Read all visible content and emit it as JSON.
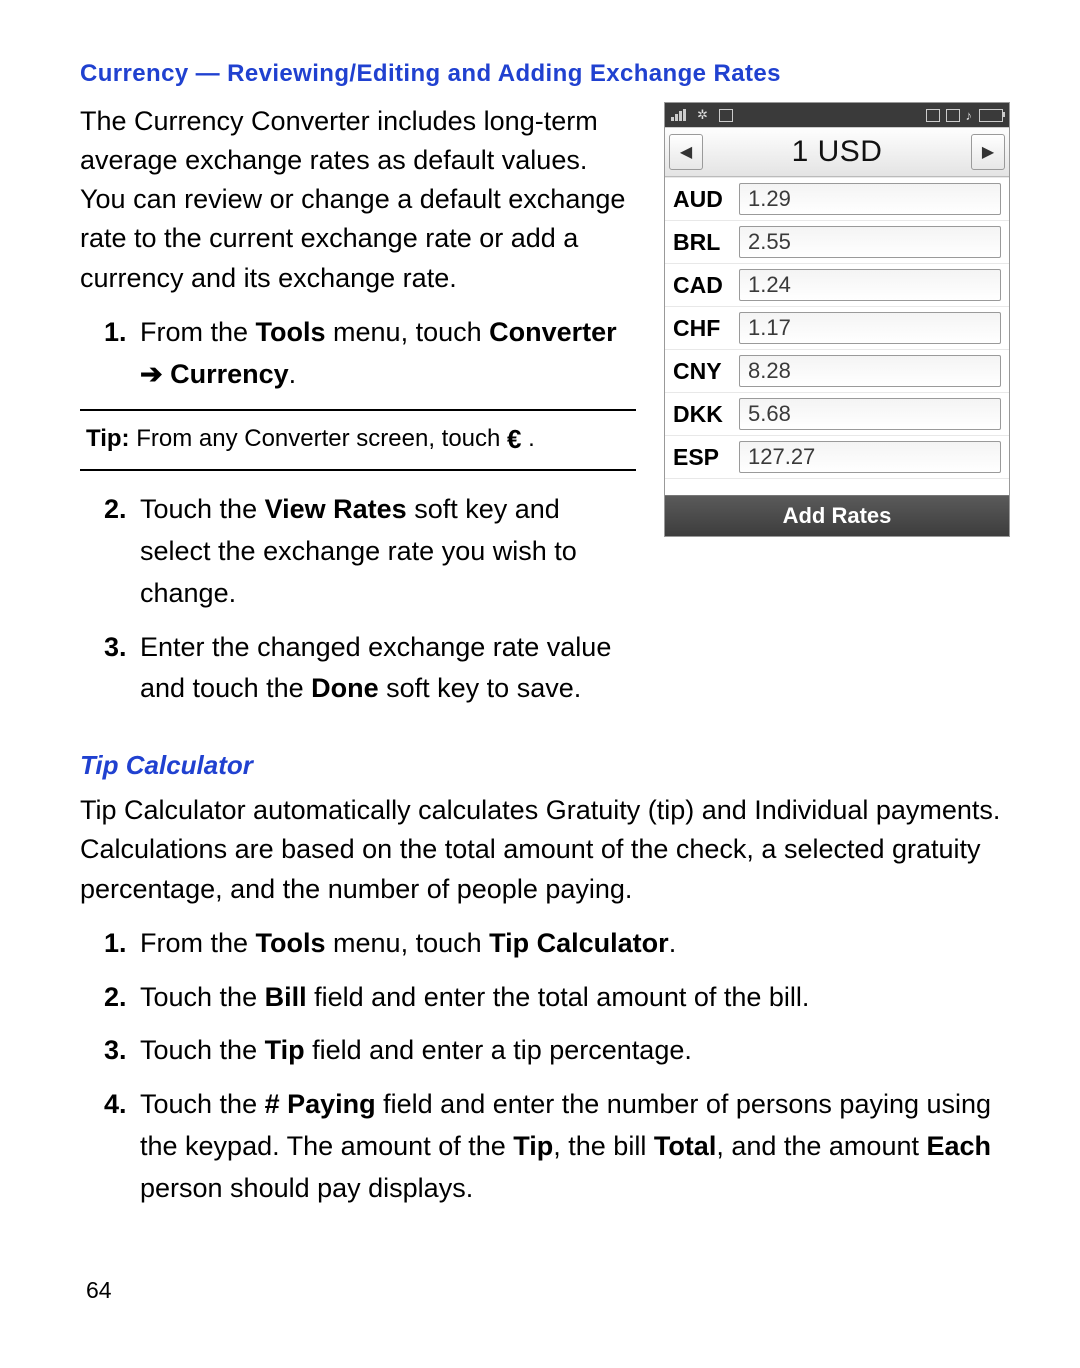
{
  "section1": {
    "heading": "Currency — Reviewing/Editing and Adding Exchange Rates",
    "intro": "The Currency Converter includes long-term average exchange rates as default values. You can review or change a default exchange rate to the current exchange rate or add a currency and its exchange rate.",
    "step1_pre": "From the ",
    "step1_b1": "Tools",
    "step1_mid": " menu, touch ",
    "step1_b2": "Converter",
    "step1_arrow": " ➔ ",
    "step1_b3": "Currency",
    "step1_post": ".",
    "tip_label": "Tip:",
    "tip_text": " From any Converter screen, touch ",
    "tip_icon": "€",
    "tip_post": " .",
    "step2_pre": "Touch the ",
    "step2_b1": "View Rates",
    "step2_post": " soft key and select the exchange rate you wish to change.",
    "step3_pre": "Enter the changed exchange rate value and touch the ",
    "step3_b1": "Done",
    "step3_post": " soft key to save."
  },
  "section2": {
    "heading": "Tip Calculator",
    "intro": "Tip Calculator automatically calculates Gratuity (tip) and Individual payments. Calculations are based on the total amount of the check, a selected gratuity percentage, and the number of people paying.",
    "s1_pre": "From the ",
    "s1_b1": "Tools",
    "s1_mid": " menu, touch ",
    "s1_b2": "Tip Calculator",
    "s1_post": ".",
    "s2_pre": "Touch the ",
    "s2_b1": "Bill",
    "s2_post": " field and enter the total amount of the bill.",
    "s3_pre": "Touch the ",
    "s3_b1": "Tip",
    "s3_post": " field and enter a tip percentage.",
    "s4_pre": "Touch the ",
    "s4_b1": "# Paying",
    "s4_mid": " field and enter the number of persons paying using the keypad. The amount of the ",
    "s4_b2": "Tip",
    "s4_mid2": ", the bill ",
    "s4_b3": "Total",
    "s4_mid3": ", and the amount ",
    "s4_b4": "Each",
    "s4_post": " person should pay displays."
  },
  "phone": {
    "title": "1 USD",
    "softkey": "Add Rates",
    "rates": [
      {
        "code": "AUD",
        "value": "1.29"
      },
      {
        "code": "BRL",
        "value": "2.55"
      },
      {
        "code": "CAD",
        "value": "1.24"
      },
      {
        "code": "CHF",
        "value": "1.17"
      },
      {
        "code": "CNY",
        "value": "8.28"
      },
      {
        "code": "DKK",
        "value": "5.68"
      },
      {
        "code": "ESP",
        "value": "127.27"
      }
    ]
  },
  "chart_data": {
    "type": "table",
    "title": "1 USD",
    "categories": [
      "AUD",
      "BRL",
      "CAD",
      "CHF",
      "CNY",
      "DKK",
      "ESP"
    ],
    "values": [
      1.29,
      2.55,
      1.24,
      1.17,
      8.28,
      5.68,
      127.27
    ]
  },
  "page_number": "64"
}
